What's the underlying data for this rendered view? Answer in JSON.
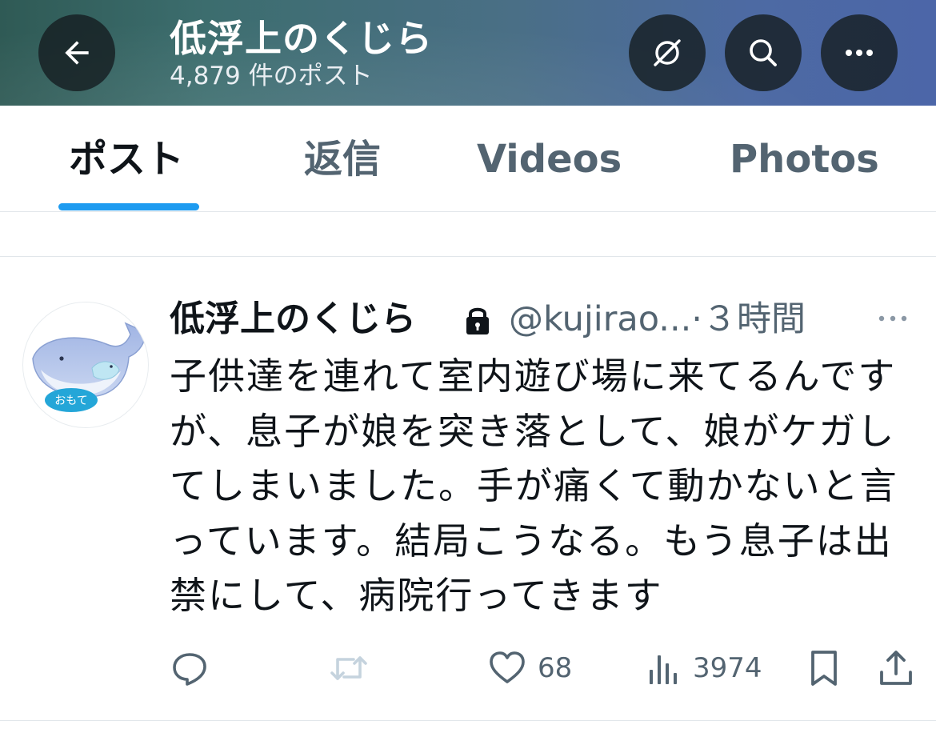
{
  "header": {
    "title": "低浮上のくじら",
    "post_count": "4,879 件のポスト",
    "icons": [
      "back-arrow-icon",
      "grok-icon",
      "search-icon",
      "more-icon"
    ]
  },
  "tabs": [
    {
      "label": "ポスト",
      "active": true
    },
    {
      "label": "返信",
      "active": false
    },
    {
      "label": "Videos",
      "active": false
    },
    {
      "label": "Photos",
      "active": false
    }
  ],
  "tweet": {
    "display_name": "低浮上のくじら",
    "handle_time": "@kujirao...·３時間",
    "avatar_badge": "おもて",
    "text": "子供達を連れて室内遊び場に来てるんですが、息子が娘を突き落として、娘がケガしてしまいました。手が痛くて動かないと言っています。結局こうなる。もう息子は出禁にして、病院行ってきます",
    "actions": {
      "likes": "68",
      "views": "3974"
    }
  },
  "colors": {
    "accent": "#1d9bf0",
    "text_primary": "#0f1419",
    "text_secondary": "#536471",
    "retweet_disabled": "#c5d3de"
  }
}
